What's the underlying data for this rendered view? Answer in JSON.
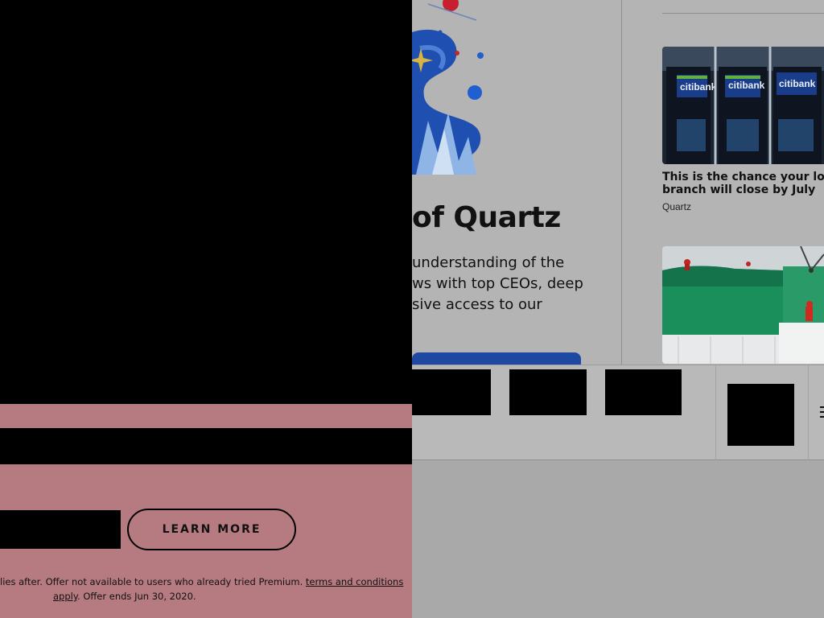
{
  "promo": {
    "title": "of Quartz",
    "description_lines": [
      "understanding of the",
      "ws with top CEOs, deep",
      "sive access to our"
    ]
  },
  "stories": [
    {
      "title_lines": [
        "This is the chance your loca",
        "branch will close by July"
      ],
      "source": "Quartz",
      "image_text": "citibank"
    },
    {
      "title_lines": [],
      "source": ""
    }
  ],
  "overlay": {
    "learn_more": "LEARN MORE",
    "fine_print_prefix": "lies after. Offer not available to users who already tried Premium. ",
    "terms_link_1": "terms and conditions",
    "terms_link_2": "apply",
    "fine_print_suffix": ". Offer ends Jun 30, 2020."
  },
  "colors": {
    "overlay_pink": "#b67b81",
    "cta_blue": "#1f48a3",
    "dim_gray": "#b4b4b4"
  },
  "icons": {
    "menu": "hamburger-menu-icon"
  }
}
